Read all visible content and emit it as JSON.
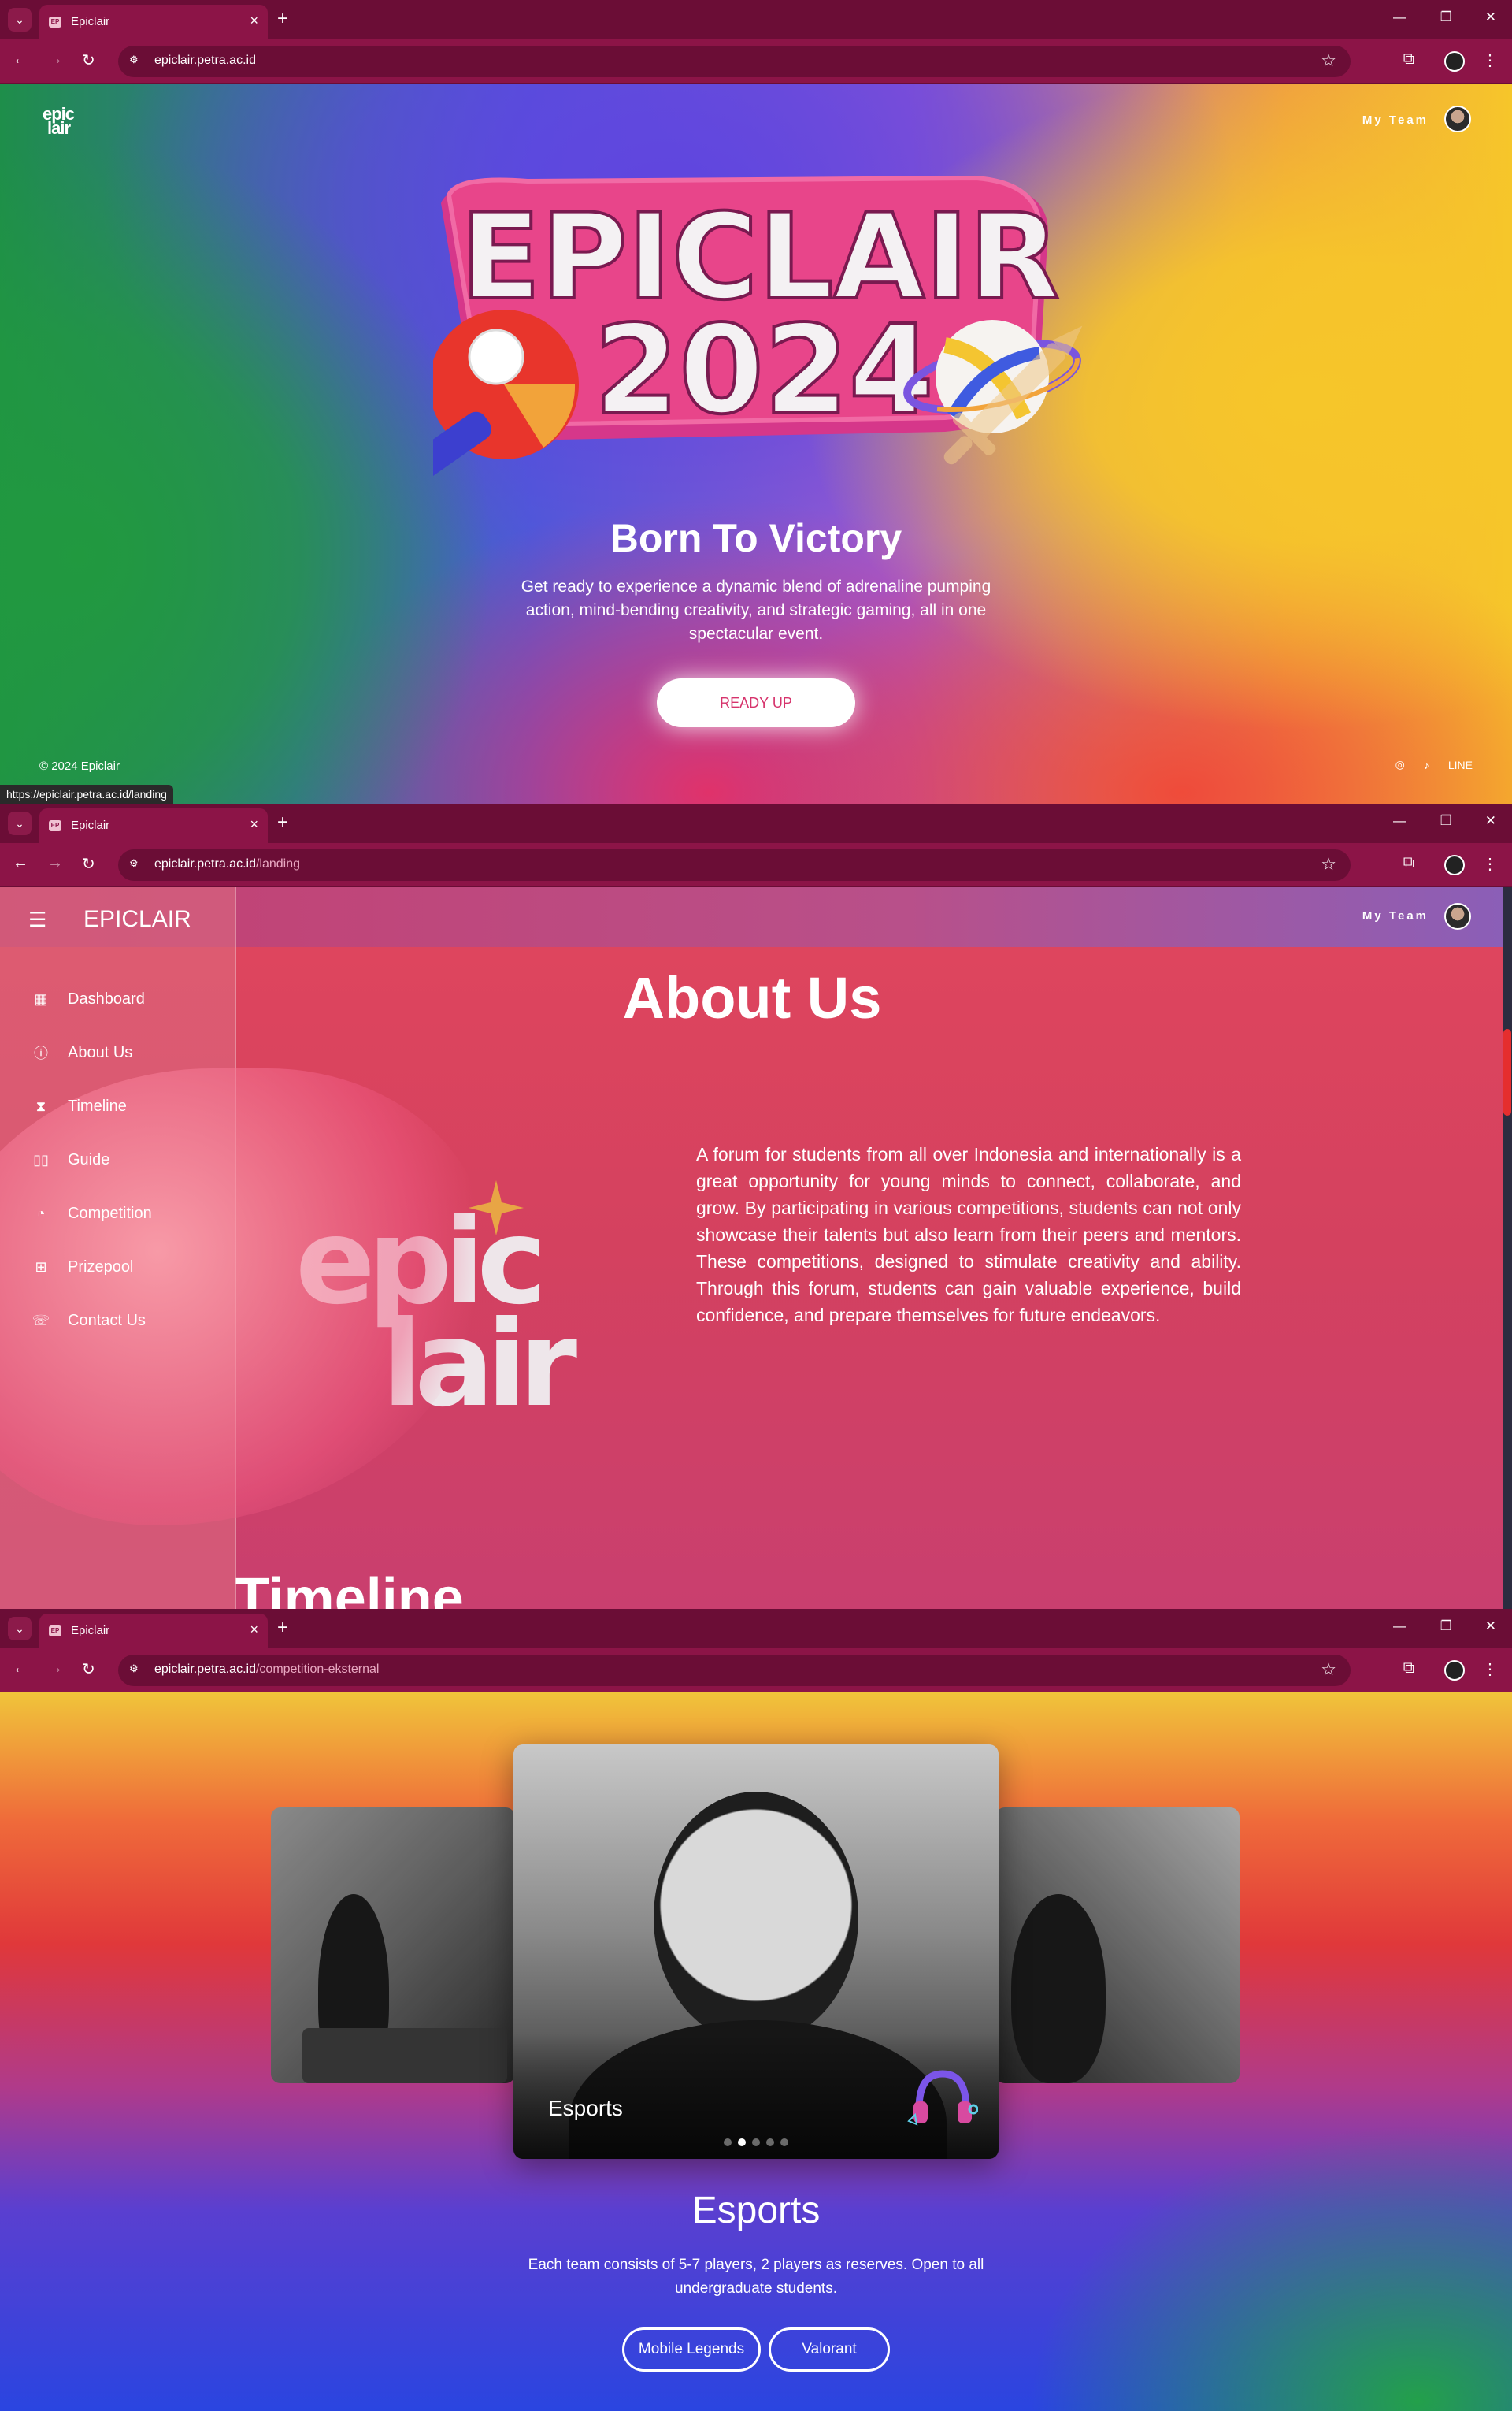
{
  "windows": [
    {
      "tab_title": "Epiclair",
      "url_host": "epiclair.petra.ac.id",
      "url_path": ""
    },
    {
      "tab_title": "Epiclair",
      "url_host": "epiclair.petra.ac.id",
      "url_path": "/landing"
    },
    {
      "tab_title": "Epiclair",
      "url_host": "epiclair.petra.ac.id",
      "url_path": "/competition-eksternal"
    }
  ],
  "landing": {
    "logo_text_1": "epic",
    "logo_text_2": "lair",
    "my_team": "My Team",
    "title_line1": "EPICLAIR",
    "title_line2": "2024",
    "tagline": "Born To Victory",
    "subtext": "Get ready to experience a dynamic blend of adrenaline pumping action, mind-bending creativity, and strategic gaming, all in one spectacular event.",
    "cta": "READY UP",
    "copyright": "© 2024 Epiclair",
    "socials": [
      "instagram-icon",
      "tiktok-icon",
      "LINE"
    ],
    "status_url": "https://epiclair.petra.ac.id/landing"
  },
  "about": {
    "brand": "EPICLAIR",
    "my_team": "My Team",
    "menu": [
      {
        "label": "Dashboard",
        "icon": "dashboard-icon"
      },
      {
        "label": "About Us",
        "icon": "info-icon"
      },
      {
        "label": "Timeline",
        "icon": "hourglass-icon"
      },
      {
        "label": "Guide",
        "icon": "book-icon"
      },
      {
        "label": "Competition",
        "icon": "gamepad-icon"
      },
      {
        "label": "Prizepool",
        "icon": "gift-icon"
      },
      {
        "label": "Contact Us",
        "icon": "phone-icon"
      }
    ],
    "title": "About Us",
    "logo_line1": "epic",
    "logo_line2": "lair",
    "body": "A forum for students from all over Indonesia and internationally is a great opportunity for young minds to connect, collaborate, and grow. By participating in various competitions, students can not only showcase their talents but also learn from their peers and mentors. These competitions, designed to stimulate creativity and ability. Through this forum, students can gain valuable experience, build confidence, and prepare themselves for future endeavors.",
    "next_section_peek": "Timeline"
  },
  "competition": {
    "slide_label": "Esports",
    "dots_total": 5,
    "dots_active": 2,
    "title": "Esports",
    "description": "Each team consists of 5-7 players, 2 players as reserves. Open to all undergraduate students.",
    "games": [
      "Mobile Legends",
      "Valorant"
    ]
  },
  "colors": {
    "chrome": "#8c1447",
    "chrome_dark": "#6b0d36",
    "cta_text": "#d6336c"
  }
}
